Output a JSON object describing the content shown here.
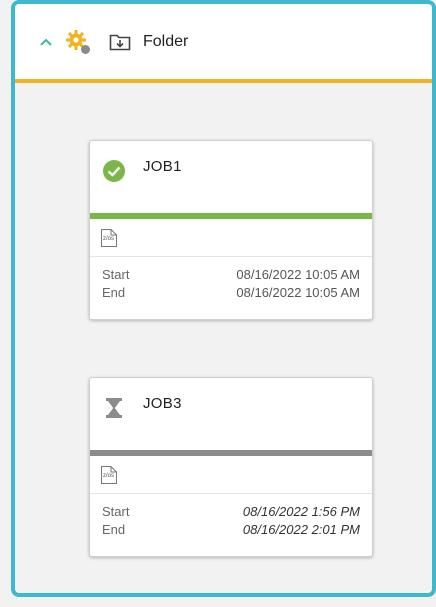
{
  "header": {
    "title": "Folder",
    "icons": [
      "chevron-up-icon",
      "gear-icon",
      "folder-icon"
    ],
    "accent_color": "#f0b323",
    "border_color": "#3cb8cf"
  },
  "jobs": [
    {
      "name": "JOB1",
      "status_icon": "check-circle-icon",
      "status_color": "#7ab648",
      "type_label": "z/os",
      "start_label": "Start",
      "start_value": "08/16/2022 10:05 AM",
      "end_label": "End",
      "end_value": "08/16/2022 10:05 AM"
    },
    {
      "name": "JOB3",
      "status_icon": "hourglass-icon",
      "status_color": "#8c8c8c",
      "type_label": "z/os",
      "start_label": "Start",
      "start_value": "08/16/2022 1:56 PM",
      "end_label": "End",
      "end_value": "08/16/2022 2:01 PM"
    }
  ]
}
